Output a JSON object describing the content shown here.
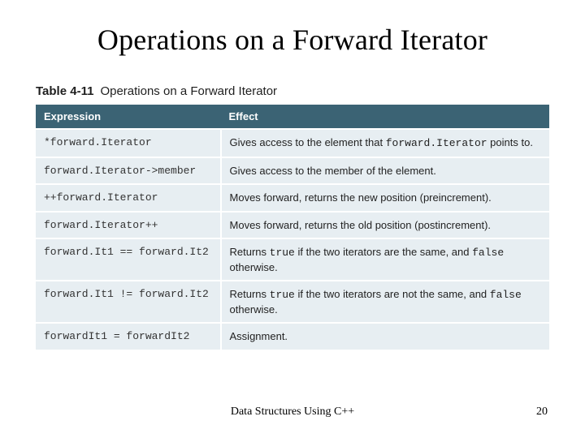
{
  "slide": {
    "title": "Operations on a Forward Iterator",
    "footer_center": "Data Structures Using C++",
    "page_number": "20"
  },
  "table": {
    "label_num": "Table 4-11",
    "label_title": "Operations on a Forward Iterator",
    "headers": {
      "expr": "Expression",
      "effect": "Effect"
    },
    "rows": [
      {
        "expr": "*forward.Iterator",
        "effect_pre": "Gives access to the element that ",
        "effect_mono": "forward.Iterator",
        "effect_post": " points to."
      },
      {
        "expr": "forward.Iterator->member",
        "effect_pre": "Gives access to the member of the element.",
        "effect_mono": "",
        "effect_post": ""
      },
      {
        "expr": "++forward.Iterator",
        "effect_pre": "Moves forward, returns the new position (preincrement).",
        "effect_mono": "",
        "effect_post": ""
      },
      {
        "expr": "forward.Iterator++",
        "effect_pre": "Moves forward, returns the old position (postincrement).",
        "effect_mono": "",
        "effect_post": ""
      },
      {
        "expr": "forward.It1 == forward.It2",
        "effect_pre": "Returns ",
        "effect_mono": "true",
        "effect_mid": " if the two iterators are the same, and ",
        "effect_mono2": "false",
        "effect_post": " otherwise."
      },
      {
        "expr": "forward.It1 != forward.It2",
        "effect_pre": "Returns ",
        "effect_mono": "true",
        "effect_mid": " if the two iterators are not the same, and ",
        "effect_mono2": "false",
        "effect_post": " otherwise."
      },
      {
        "expr": "forwardIt1 = forwardIt2",
        "effect_pre": "Assignment.",
        "effect_mono": "",
        "effect_post": ""
      }
    ]
  }
}
